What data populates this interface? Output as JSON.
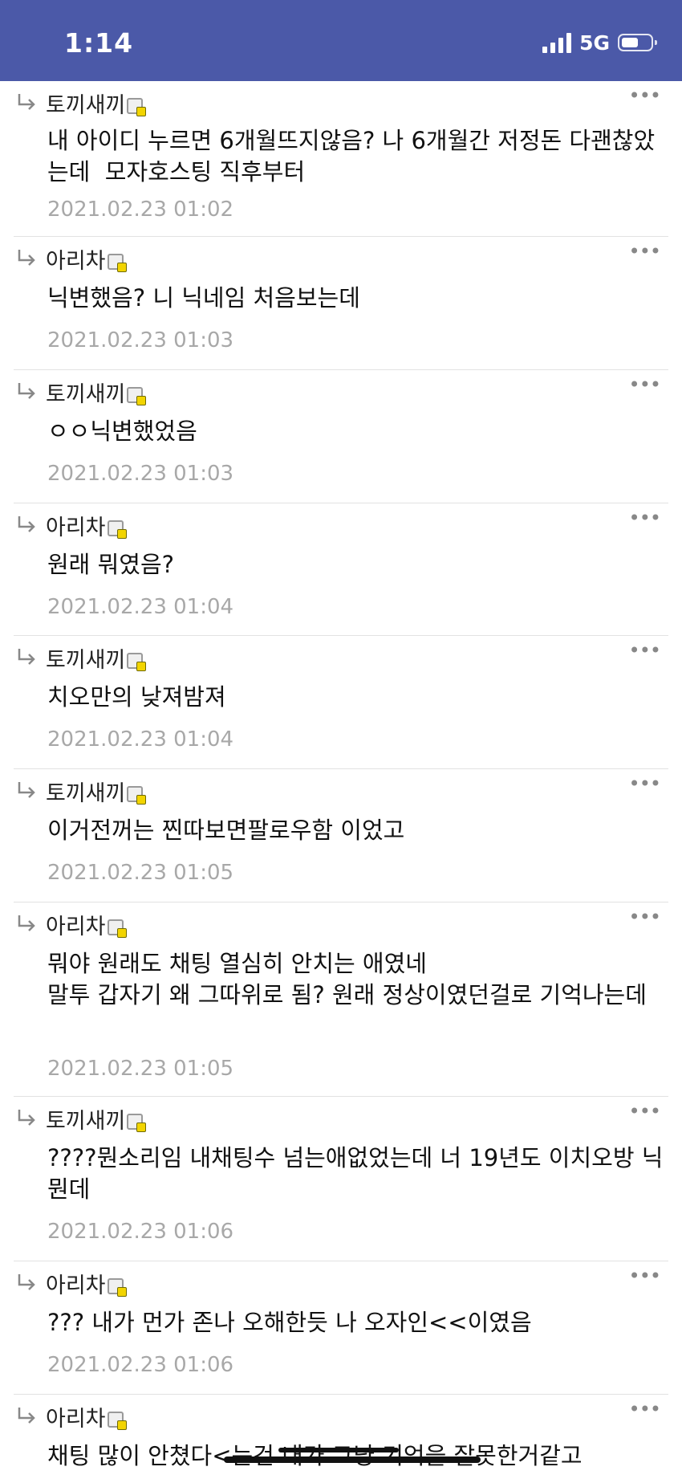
{
  "status_bar": {
    "time": "1:14",
    "network": "5G"
  },
  "comments": [
    {
      "author": "토끼새끼",
      "text": "내 아이디 누르면 6개월뜨지않음? 나 6개월간 저정돈 다괜찮았는데  모자호스팅 직후부터",
      "date": "2021.02.23 01:02"
    },
    {
      "author": "아리차",
      "text": "닉변했음? 니 닉네임 처음보는데",
      "date": "2021.02.23 01:03"
    },
    {
      "author": "토끼새끼",
      "text": "ㅇㅇ닉변했었음",
      "date": "2021.02.23 01:03"
    },
    {
      "author": "아리차",
      "text": "원래 뭐였음?",
      "date": "2021.02.23 01:04"
    },
    {
      "author": "토끼새끼",
      "text": "치오만의 낮져밤져",
      "date": "2021.02.23 01:04"
    },
    {
      "author": "토끼새끼",
      "text": "이거전꺼는 찐따보면팔로우함 이었고",
      "date": "2021.02.23 01:05"
    },
    {
      "author": "아리차",
      "text": "뭐야 원래도 채팅 열심히 안치는 애였네\n말투 갑자기 왜 그따위로 됨? 원래 정상이였던걸로 기억나는데",
      "date": "2021.02.23 01:05"
    },
    {
      "author": "토끼새끼",
      "text": "????뭔소리임 내채팅수 넘는애없었는데 너 19년도 이치오방 닉뭔데",
      "date": "2021.02.23 01:06"
    },
    {
      "author": "아리차",
      "text": "??? 내가 먼가 존나 오해한듯 나 오자인<<이였음",
      "date": "2021.02.23 01:06"
    },
    {
      "author": "아리차",
      "text": "채팅 많이 안쳤다<는건 내가 그냥 기억을 잘못한거같고",
      "date": ""
    }
  ],
  "more_label": "•••"
}
